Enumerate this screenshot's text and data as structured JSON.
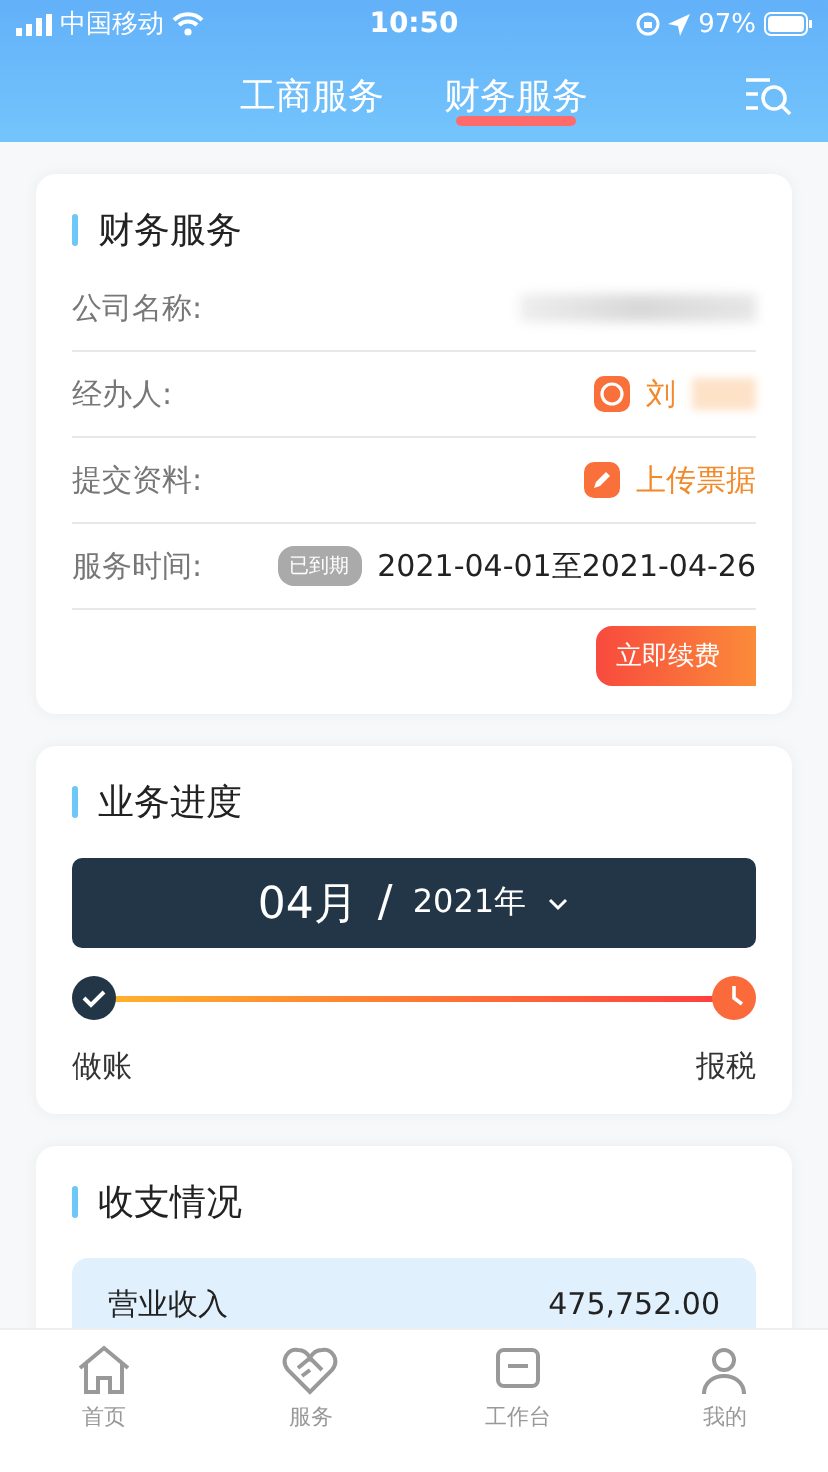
{
  "status_bar": {
    "carrier": "中国移动",
    "time": "10:50",
    "battery": "97%"
  },
  "nav_tabs": [
    {
      "label": "工商服务",
      "selected": false
    },
    {
      "label": "财务服务",
      "selected": true
    }
  ],
  "service_card": {
    "title": "财务服务",
    "rows": [
      {
        "kind": "blurred",
        "label": "公司名称:"
      },
      {
        "kind": "person",
        "label": "经办人:",
        "value": "刘"
      },
      {
        "kind": "upload",
        "label": "提交资料:",
        "value": "上传票据"
      },
      {
        "kind": "period",
        "label": "服务时间:",
        "badge": "已到期",
        "value": "2021-04-01至2021-04-26"
      }
    ],
    "renew_button": "立即续费"
  },
  "progress_card": {
    "title": "业务进度",
    "month": "04月",
    "separator": "/",
    "year": "2021年",
    "steps": [
      {
        "label": "做账",
        "done": true
      },
      {
        "label": "报税",
        "done": false
      }
    ]
  },
  "finance_card": {
    "title": "收支情况",
    "rows": [
      {
        "label": "营业收入",
        "value": "475,752.00"
      }
    ]
  },
  "tab_bar": [
    {
      "label": "首页",
      "kind": "home",
      "selected": false
    },
    {
      "label": "服务",
      "kind": "service",
      "selected": false
    },
    {
      "label": "工作台",
      "kind": "workbench",
      "selected": false
    },
    {
      "label": "我的",
      "kind": "profile",
      "selected": false
    }
  ]
}
